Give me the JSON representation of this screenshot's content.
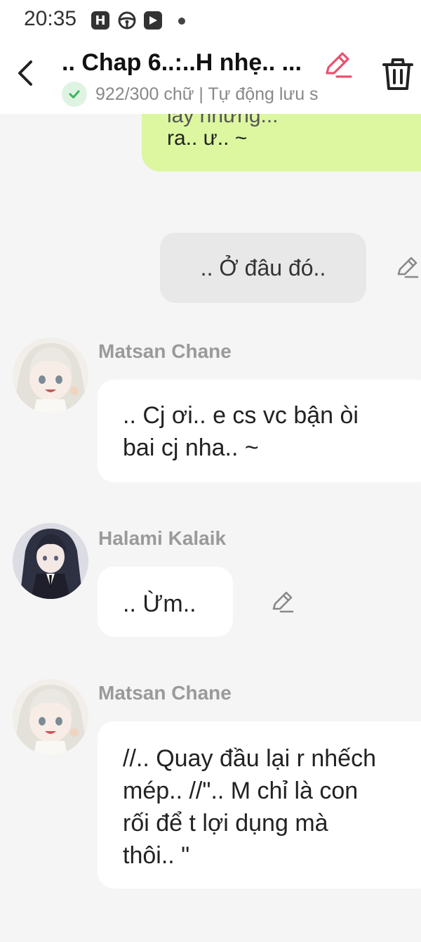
{
  "status_bar": {
    "time": "20:35",
    "icons": [
      "h-app-icon",
      "steering-wheel-icon",
      "play-store-icon",
      "notification-dot"
    ]
  },
  "header": {
    "title": ".. Chap 6..:..H nhẹ.. ...",
    "subtitle": "922/300 chữ | Tự động lưu s",
    "icons": [
      "back-arrow-icon",
      "edit-pencil-icon",
      "trash-icon",
      "check-icon"
    ],
    "accent_color": "#e8526f"
  },
  "messages": {
    "partial_green": {
      "ghost_text": "lay nhưng...",
      "line2": "ra..  ư.. ~"
    },
    "my_action": {
      "text": ".. Ở đâu đó.."
    },
    "m1": {
      "sender": "Matsan Chane",
      "lines": [
        ".. Cj ơi.. e cs vc bận òi",
        "bai cj nha.. ~"
      ]
    },
    "m2": {
      "sender": "Halami Kalaik",
      "lines": [
        ".. Ừm.."
      ]
    },
    "m3": {
      "sender": "Matsan Chane",
      "lines": [
        "//.. Quay đầu lại r nhếch",
        "mép.. //\".. M chỉ là con",
        "rối để t lợi dụng mà",
        "thôi.. \""
      ]
    }
  },
  "colors": {
    "green_bubble": "#dcf7a0",
    "gray_bubble": "#e8e8e8",
    "white_bubble": "#ffffff",
    "background": "#f5f5f5",
    "sender_name": "#9a9a9a"
  }
}
